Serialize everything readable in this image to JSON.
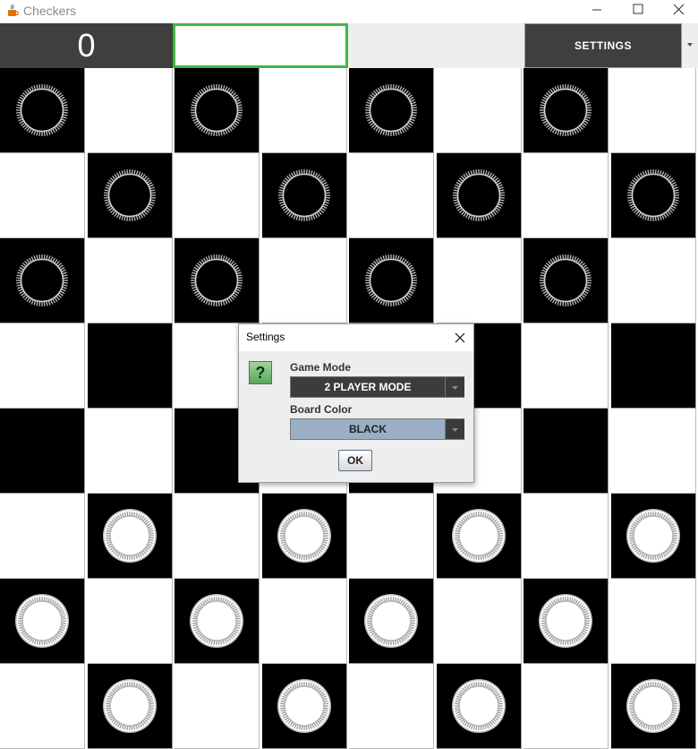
{
  "window": {
    "title": "Checkers",
    "app_icon": "java-cup-icon",
    "controls": [
      "minimize-icon",
      "maximize-icon",
      "close-icon"
    ]
  },
  "toolbar": {
    "score": "0",
    "name_field_value": "",
    "settings_label": "SETTINGS",
    "accent_color": "#3fb83f"
  },
  "board": {
    "size": 8,
    "dark_square_color": "#000000",
    "light_square_color": "#ffffff",
    "rows": [
      "d.d.d.d.",
      ".d.d.d.d",
      "d.d.d.d.",
      "........",
      "........",
      ".l.l.l.l",
      "l.l.l.l.",
      ".l.l.l.l"
    ],
    "piece_legend": {
      "d": "dark-checker",
      "l": "light-checker",
      ".": "empty"
    }
  },
  "dialog": {
    "title": "Settings",
    "icon": "question-icon",
    "icon_glyph": "?",
    "game_mode_label": "Game Mode",
    "game_mode_value": "2 PLAYER MODE",
    "board_color_label": "Board Color",
    "board_color_value": "BLACK",
    "ok_label": "OK"
  }
}
